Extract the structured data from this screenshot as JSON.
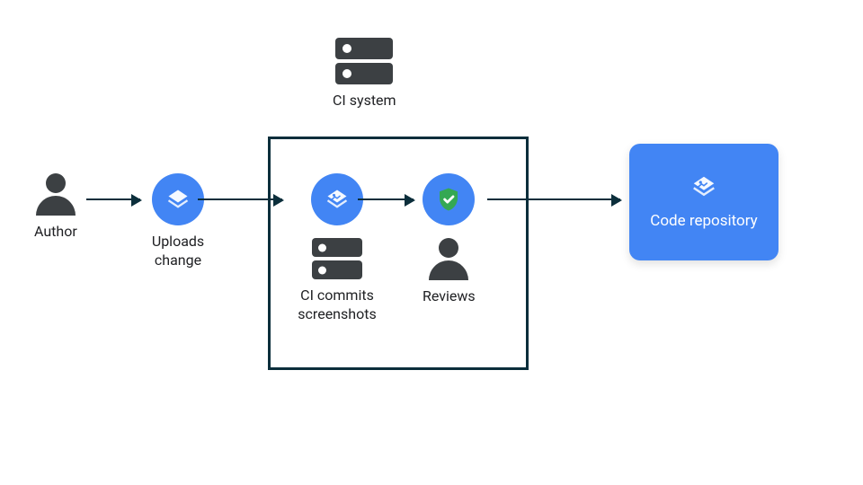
{
  "colors": {
    "blue": "#4285f4",
    "dark": "#3c4043",
    "outline": "#0b2e3b",
    "green": "#34a853",
    "white": "#ffffff"
  },
  "nodes": {
    "author": {
      "label": "Author"
    },
    "uploads": {
      "label": "Uploads change"
    },
    "ci_system": {
      "label": "CI system"
    },
    "ci_commits": {
      "label": "CI commits screenshots"
    },
    "reviews": {
      "label": "Reviews"
    },
    "repo": {
      "label": "Code repository"
    }
  },
  "flow": [
    "author",
    "uploads",
    "ci_commits",
    "reviews",
    "repo"
  ],
  "boxed_group": [
    "ci_commits",
    "reviews"
  ],
  "boxed_group_header": "ci_system"
}
